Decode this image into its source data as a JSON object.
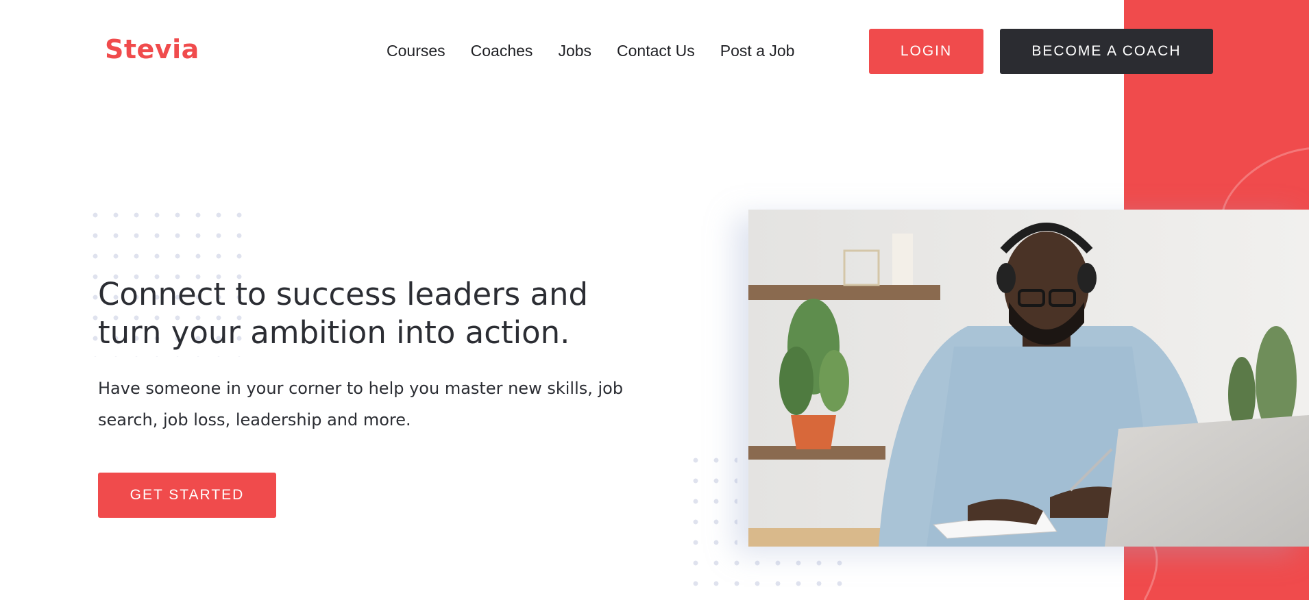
{
  "brand": {
    "logo_text": "Stevia",
    "accent_color": "#f04b4c",
    "dark_color": "#2b2c31"
  },
  "nav": {
    "items": [
      {
        "label": "Courses"
      },
      {
        "label": "Coaches"
      },
      {
        "label": "Jobs"
      },
      {
        "label": "Contact Us"
      },
      {
        "label": "Post a Job"
      }
    ]
  },
  "header_actions": {
    "login_label": "LOGIN",
    "coach_label": "BECOME A COACH"
  },
  "hero": {
    "headline": "Connect to success leaders and turn your ambition into action.",
    "subtext": "Have someone in your corner to help you master new skills, job search, job loss, leadership and more.",
    "cta_label": "GET STARTED",
    "image": {
      "icon": "photo-icon"
    }
  }
}
